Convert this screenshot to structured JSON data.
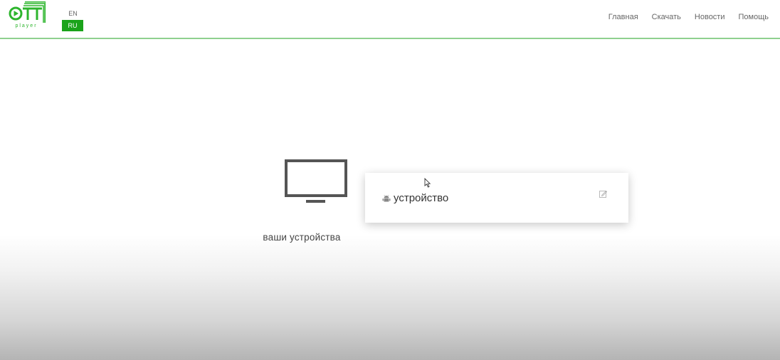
{
  "header": {
    "logo": {
      "icon": "ott-player-logo",
      "text": "player"
    },
    "lang": {
      "en": "EN",
      "ru": "RU",
      "active": "RU"
    },
    "nav": [
      {
        "label": "Главная"
      },
      {
        "label": "Скачать"
      },
      {
        "label": "Новости"
      },
      {
        "label": "Помощь"
      }
    ]
  },
  "main": {
    "devices_icon": "tv-icon",
    "devices_label": "ваши устройства",
    "device_card": {
      "icon": "android-icon",
      "name": "устройство",
      "edit_icon": "edit-icon"
    }
  },
  "colors": {
    "accent": "#1aa31a",
    "divider": "#8fd08f"
  }
}
